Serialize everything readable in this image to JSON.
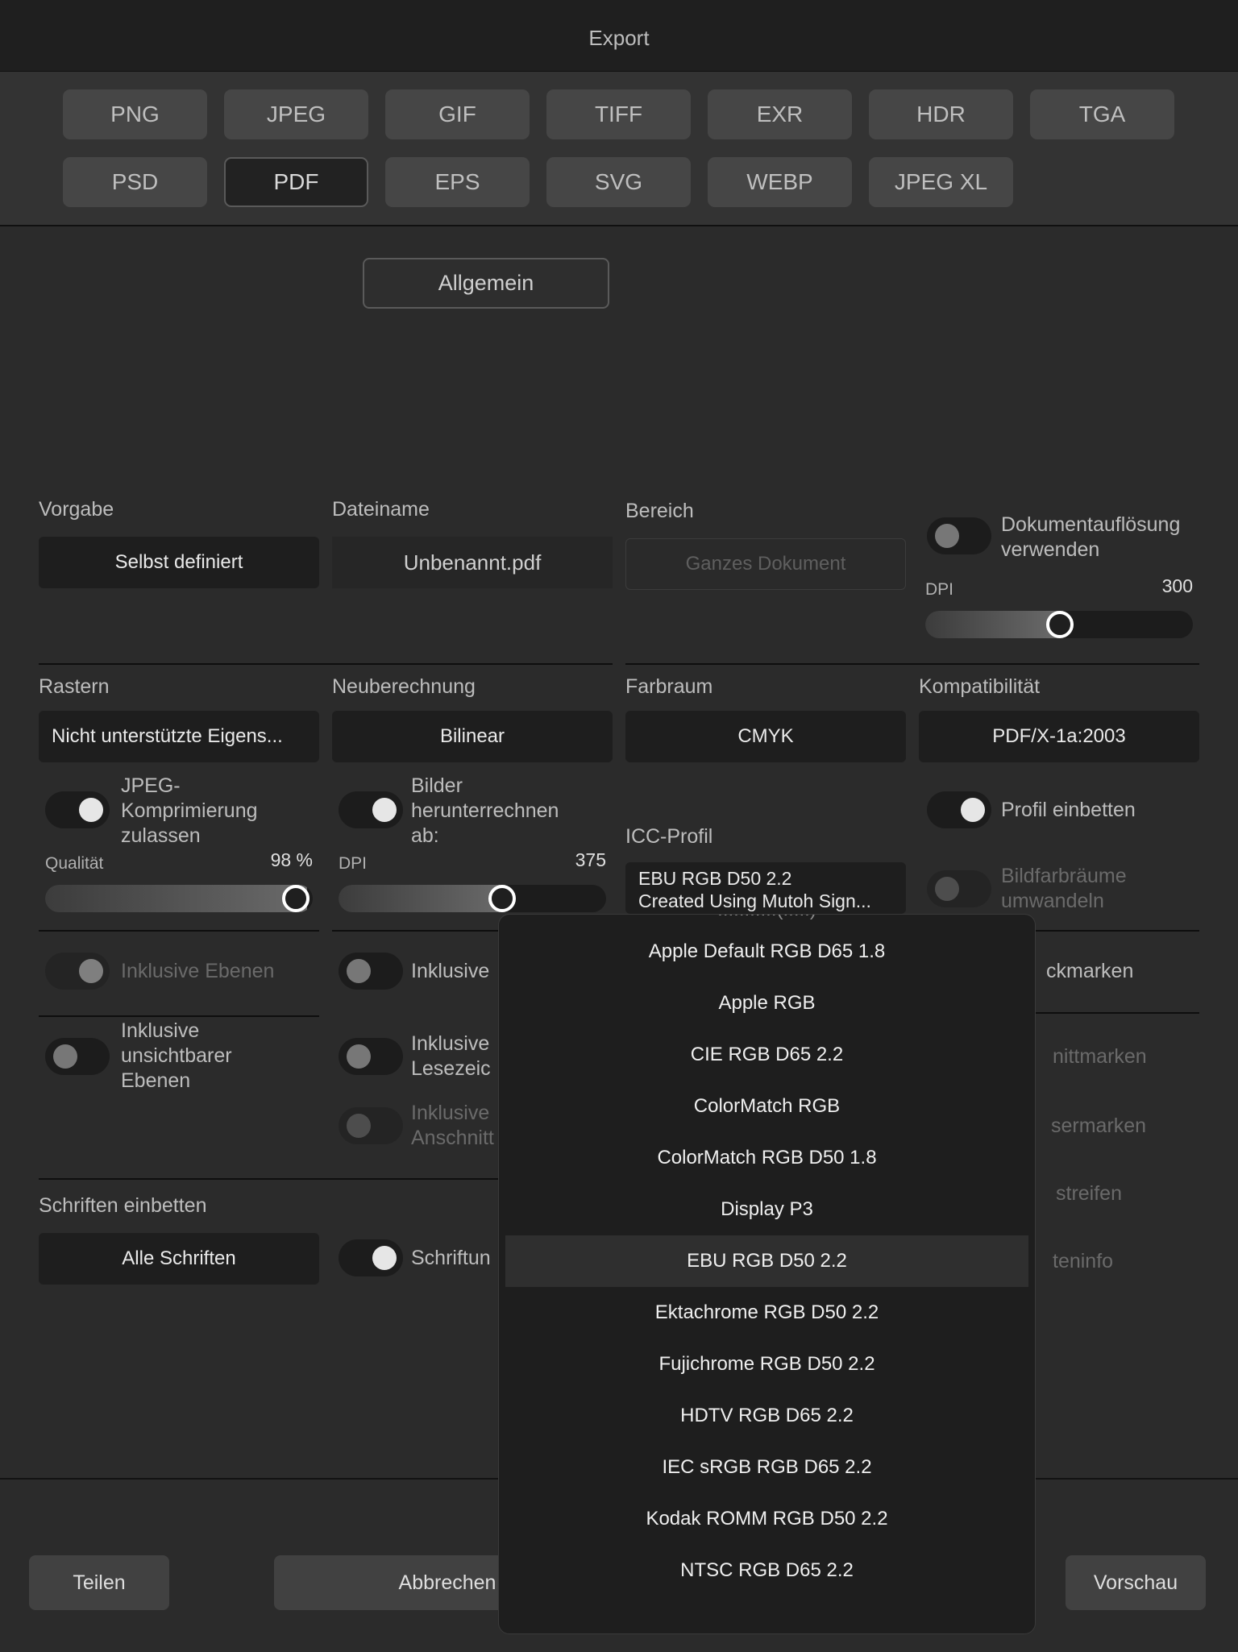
{
  "window": {
    "title": "Export"
  },
  "formats": [
    "PNG",
    "JPEG",
    "GIF",
    "TIFF",
    "EXR",
    "HDR",
    "TGA",
    "PSD",
    "PDF",
    "EPS",
    "SVG",
    "WEBP",
    "JPEG XL"
  ],
  "selected_format": "PDF",
  "section_button": "Allgemein",
  "vorgabe": {
    "label": "Vorgabe",
    "value": "Selbst definiert"
  },
  "dateiname": {
    "label": "Dateiname",
    "value": "Unbenannt.pdf"
  },
  "bereich": {
    "label": "Bereich",
    "value": "Ganzes Dokument"
  },
  "dokumentaufloesung": {
    "line1": "Dokumentauflösung",
    "line2": "verwenden",
    "on": false
  },
  "dpi_main": {
    "label": "DPI",
    "value": "300",
    "fraction": 0.5
  },
  "rastern": {
    "label": "Rastern",
    "value": "Nicht unterstützte Eigens..."
  },
  "neuberechnung": {
    "label": "Neuberechnung",
    "value": "Bilinear"
  },
  "farbraum": {
    "label": "Farbraum",
    "value": "CMYK"
  },
  "kompatibilitaet": {
    "label": "Kompatibilität",
    "value": "PDF/X-1a:2003"
  },
  "jpeg": {
    "line1": "JPEG-",
    "line2": "Komprimierung",
    "line3": "zulassen",
    "on": true
  },
  "qualitaet": {
    "label": "Qualität",
    "value": "98 %",
    "fraction": 0.98
  },
  "bilder": {
    "line1": "Bilder",
    "line2": "herunterrechnen",
    "line3": "ab:",
    "on": true
  },
  "dpi_bilder": {
    "label": "DPI",
    "value": "375",
    "fraction": 0.62
  },
  "icc": {
    "label": "ICC-Profil",
    "line1": "EBU RGB D50 2.2",
    "line2": "Created Using Mutoh Sign..."
  },
  "profil_einbetten": {
    "label": "Profil einbetten",
    "on": true
  },
  "bildfarbraeume": {
    "line1": "Bildfarbräume",
    "line2": "umwandeln"
  },
  "inklusive_ebenen": "Inklusive Ebenen",
  "inklusive_partial": "Inklusive",
  "beschnittmarken_partial": "ckmarken",
  "inklusive_unsichtbar": {
    "line1": "Inklusive",
    "line2": "unsichtbarer",
    "line3": "Ebenen"
  },
  "lesezeichen_partial": {
    "line1": "Inklusive",
    "line2": "Lesezeic"
  },
  "anschnitt_partial": {
    "line1": "Inklusive",
    "line2": "Anschnitt"
  },
  "schnittmarken_partial": "nittmarken",
  "passermarken_partial": "sermarken",
  "farbstreifen_partial": "streifen",
  "dateiinfo_partial": "teninfo",
  "schriften": {
    "label": "Schriften einbetten",
    "value": "Alle Schriften",
    "toggle_label": "Schriftun"
  },
  "bottom": {
    "share": "Teilen",
    "cancel": "Abbrechen",
    "preview": "Vorschau"
  },
  "dropdown": {
    "cut_off_item": "...........(.....)",
    "items": [
      "Apple Default RGB D65 1.8",
      "Apple RGB",
      "CIE RGB D65 2.2",
      "ColorMatch RGB",
      "ColorMatch RGB D50 1.8",
      "Display P3",
      "EBU RGB D50 2.2",
      "Ektachrome RGB D50 2.2",
      "Fujichrome RGB D50 2.2",
      "HDTV RGB D65 2.2",
      "IEC sRGB RGB D65 2.2",
      "Kodak ROMM RGB D50 2.2",
      "NTSC RGB D65 2.2"
    ],
    "selected": "EBU RGB D50 2.2"
  }
}
